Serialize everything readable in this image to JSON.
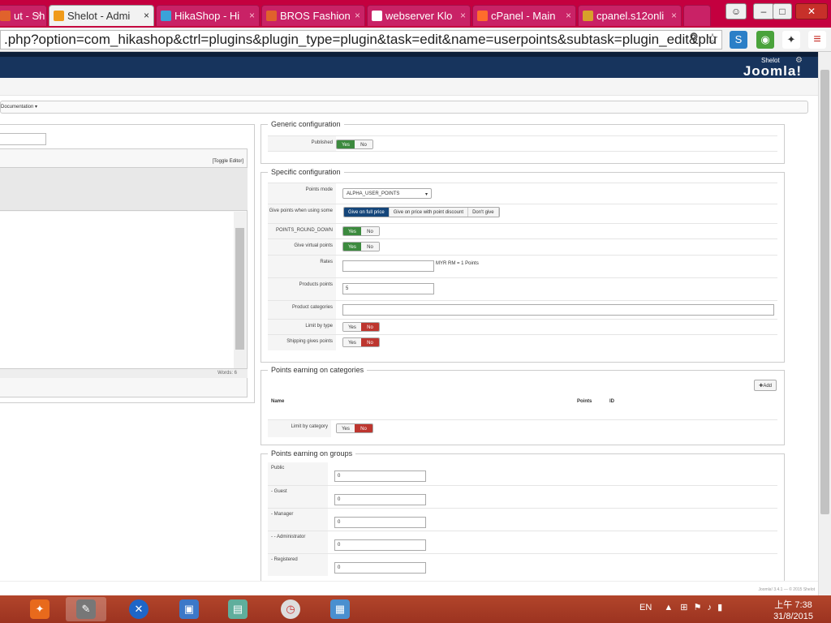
{
  "browser": {
    "tabs": [
      {
        "title": "ut - Sh",
        "color": "#e0622c"
      },
      {
        "title": "Shelot - Admi",
        "color": "#f09a1a"
      },
      {
        "title": "HikaShop - Hi",
        "color": "#3aa2d8"
      },
      {
        "title": "BROS Fashion",
        "color": "#e0622c"
      },
      {
        "title": "webserver Klo",
        "color": "#ffffff"
      },
      {
        "title": "cPanel - Main",
        "color": "#ff6c2c"
      },
      {
        "title": "cpanel.s12onli",
        "color": "#d8a02a"
      }
    ],
    "url": ".php?option=com_hikashop&ctrl=plugins&plugin_type=plugin&task=edit&name=userpoints&subtask=plugin_edit&plu",
    "close_glyph": "×"
  },
  "admin": {
    "user": "Shelot",
    "brand": "Joomla!"
  },
  "documentation": "Documentation",
  "editor": {
    "toggle": "[Toggle Editor]",
    "words": "Words: 6"
  },
  "generic": {
    "legend": "Generic configuration",
    "published": "Published",
    "yes": "Yes",
    "no": "No"
  },
  "specific": {
    "legend": "Specific configuration",
    "points_mode_label": "Points mode",
    "points_mode_value": "ALPHA_USER_POINTS",
    "give_when_label": "Give points when using some",
    "give_opts": [
      "Give on full price",
      "Give on price with point discount",
      "Don't give"
    ],
    "round_label": "POINTS_ROUND_DOWN",
    "virtual_label": "Give virtual points",
    "rates_label": "Rates",
    "rates_suffix": "MYR RM = 1 Points",
    "products_label": "Products points",
    "products_value": "5",
    "categories_label": "Product categories",
    "limit_label": "Limit by type",
    "shipping_label": "Shipping gives points"
  },
  "categories": {
    "legend": "Points earning on categories",
    "add": "Add",
    "col_name": "Name",
    "col_points": "Points",
    "col_id": "ID",
    "limit_label": "Limit by category"
  },
  "groups": {
    "legend": "Points earning on groups",
    "items": [
      {
        "label": "Public",
        "value": "0"
      },
      {
        "label": "- Guest",
        "value": "0"
      },
      {
        "label": "- Manager",
        "value": "0"
      },
      {
        "label": "- - Administrator",
        "value": "0"
      },
      {
        "label": "- Registered",
        "value": "0"
      }
    ]
  },
  "footer": "Joomla! 3.4.1 — © 2015 Shelot",
  "taskbar": {
    "lang": "EN",
    "time": "上午 7:38",
    "date": "31/8/2015"
  }
}
